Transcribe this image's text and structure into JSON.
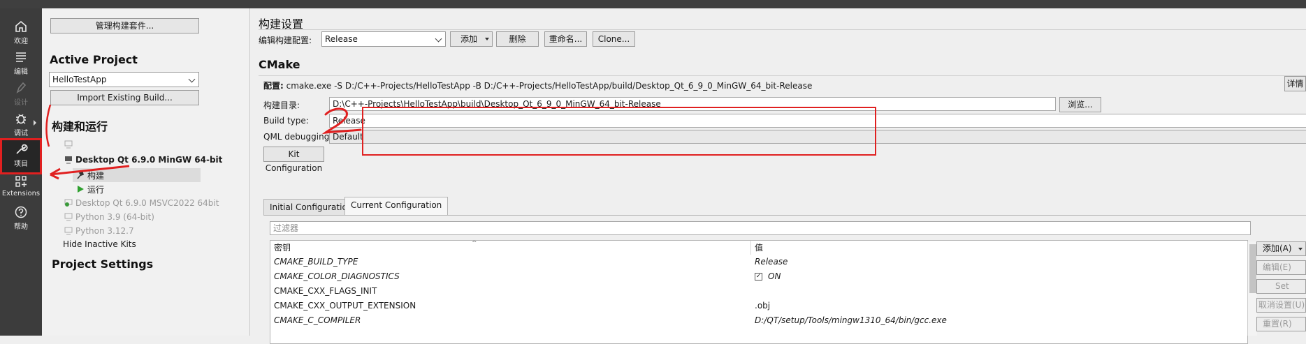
{
  "modebar": {
    "items": [
      {
        "label": "欢迎",
        "icon": "home-icon"
      },
      {
        "label": "编辑",
        "icon": "edit-lines-icon"
      },
      {
        "label": "设计",
        "icon": "pen-icon"
      },
      {
        "label": "调试",
        "icon": "bug-icon"
      },
      {
        "label": "项目",
        "icon": "wrench-icon"
      },
      {
        "label": "Extensions",
        "icon": "extensions-icon"
      },
      {
        "label": "帮助",
        "icon": "help-icon"
      }
    ]
  },
  "project_panel": {
    "manage_kits_button": "管理构建套件...",
    "active_project_heading": "Active Project",
    "active_project_value": "HelloTestApp",
    "import_button": "Import Existing Build...",
    "build_run_heading": "构建和运行",
    "kits": [
      {
        "name": "Desktop Qt 6.9.0 MinGW 64-bit",
        "active": true,
        "children": [
          {
            "label": "构建",
            "icon": "hammer-icon",
            "selected": true
          },
          {
            "label": "运行",
            "icon": "play-icon",
            "selected": false
          }
        ]
      },
      {
        "name": "Desktop Qt 6.9.0 MSVC2022 64bit",
        "active": false
      },
      {
        "name": "Python 3.9 (64-bit)",
        "active": false
      },
      {
        "name": "Python 3.12.7",
        "active": false
      }
    ],
    "hide_inactive": "Hide Inactive Kits",
    "project_settings_heading": "Project Settings"
  },
  "build_settings": {
    "title": "构建设置",
    "edit_config_label": "编辑构建配置:",
    "config_value": "Release",
    "add_button": "添加",
    "delete_button": "删除",
    "rename_button": "重命名...",
    "clone_button": "Clone..."
  },
  "cmake": {
    "heading": "CMake",
    "config_label": "配置:",
    "config_command": "cmake.exe -S D:/C++-Projects/HelloTestApp -B D:/C++-Projects/HelloTestApp/build/Desktop_Qt_6_9_0_MinGW_64_bit-Release",
    "details_button": "详情",
    "build_dir_label": "构建目录:",
    "build_dir_value": "D:\\C++-Projects\\HelloTestApp\\build\\Desktop_Qt_6_9_0_MinGW_64_bit-Release",
    "browse_button": "浏览...",
    "build_type_label": "Build type:",
    "build_type_value": "Release",
    "qml_label": "QML debugging and profiling:",
    "qml_value": "Default",
    "kit_config_button": "Kit Configuration",
    "tabs": [
      "Initial Configuration",
      "Current Configuration"
    ],
    "filter_placeholder": "过滤器",
    "columns": [
      "密钥",
      "值"
    ],
    "rows": [
      {
        "key": "CMAKE_BUILD_TYPE",
        "value": "Release",
        "italic": true
      },
      {
        "key": "CMAKE_COLOR_DIAGNOSTICS",
        "value": "ON",
        "italic": true,
        "checkbox": true
      },
      {
        "key": "CMAKE_CXX_FLAGS_INIT",
        "value": "",
        "italic": false
      },
      {
        "key": "CMAKE_CXX_OUTPUT_EXTENSION",
        "value": ".obj",
        "italic": false
      },
      {
        "key": "CMAKE_C_COMPILER",
        "value": "D:/QT/setup/Tools/mingw1310_64/bin/gcc.exe",
        "italic": true
      }
    ],
    "side_buttons": [
      {
        "label": "添加(A)",
        "enabled": true
      },
      {
        "label": "编辑(E)",
        "enabled": false
      },
      {
        "label": "Set",
        "enabled": false
      },
      {
        "label": "取消设置(U)",
        "enabled": false
      },
      {
        "label": "重置(R)",
        "enabled": false
      }
    ]
  },
  "annotation": {
    "handwritten_text": "2",
    "color": "#e02020"
  }
}
